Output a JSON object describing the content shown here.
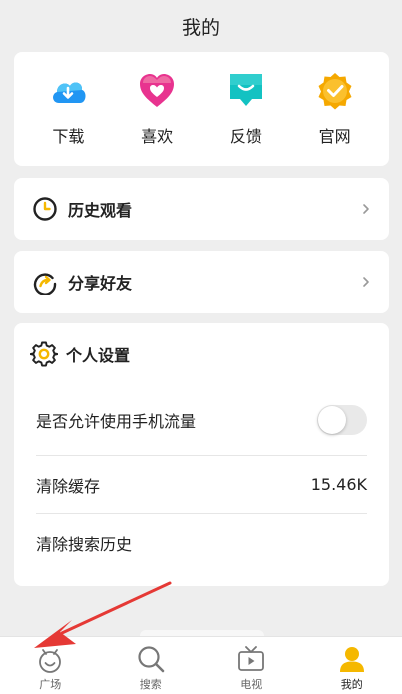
{
  "header": {
    "title": "我的"
  },
  "quick_actions": [
    {
      "label": "下载",
      "icon": "download-cloud-icon",
      "color": "#2196f3"
    },
    {
      "label": "喜欢",
      "icon": "heart-icon",
      "color": "#e8338f"
    },
    {
      "label": "反馈",
      "icon": "feedback-icon",
      "color": "#13c2c2"
    },
    {
      "label": "官网",
      "icon": "official-site-badge-icon",
      "color": "#f5a800"
    }
  ],
  "menu": {
    "history": {
      "label": "历史观看",
      "icon": "clock-icon"
    },
    "share": {
      "label": "分享好友",
      "icon": "share-icon"
    }
  },
  "settings": {
    "title": "个人设置",
    "icon": "gear-icon",
    "mobile_data_label": "是否允许使用手机流量",
    "mobile_data_enabled": false,
    "clear_cache_label": "清除缓存",
    "cache_size": "15.46K",
    "clear_search_label": "清除搜索历史"
  },
  "tabbar": {
    "active": "mine",
    "tabs": [
      {
        "id": "square",
        "label": "广场",
        "icon": "square-face-icon"
      },
      {
        "id": "search",
        "label": "搜索",
        "icon": "search-icon"
      },
      {
        "id": "tv",
        "label": "电视",
        "icon": "tv-icon"
      },
      {
        "id": "mine",
        "label": "我的",
        "icon": "user-icon"
      }
    ]
  },
  "annotation": {
    "color": "#e53935",
    "icon": "red-arrow-annotation"
  },
  "colors": {
    "accent": "#f5b800",
    "background": "#eeeeee"
  }
}
